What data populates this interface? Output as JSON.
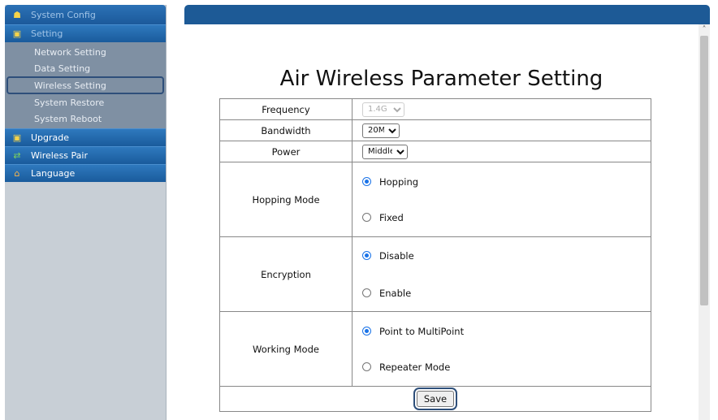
{
  "sidebar": {
    "header": "System Config",
    "setting_label": "Setting",
    "sub_items": [
      "Network Setting",
      "Data Setting",
      "Wireless Setting",
      "System Restore",
      "System Reboot"
    ],
    "upgrade_label": "Upgrade",
    "wireless_pair_label": "Wireless Pair",
    "language_label": "Language"
  },
  "page": {
    "title": "Air Wireless Parameter Setting"
  },
  "form": {
    "frequency": {
      "label": "Frequency",
      "value": "1.4G"
    },
    "bandwidth": {
      "label": "Bandwidth",
      "value": "20M"
    },
    "power": {
      "label": "Power",
      "value": "Middle"
    },
    "hopping_mode": {
      "label": "Hopping Mode",
      "options": [
        "Hopping",
        "Fixed"
      ],
      "selected": "Hopping"
    },
    "encryption": {
      "label": "Encryption",
      "options": [
        "Disable",
        "Enable"
      ],
      "selected": "Disable"
    },
    "working_mode": {
      "label": "Working Mode",
      "options": [
        "Point to MultiPoint",
        "Repeater Mode"
      ],
      "selected": "Point to MultiPoint"
    },
    "save_label": "Save"
  },
  "colors": {
    "sidebar_header": "#1b5a9b",
    "main_topbar": "#1d5a96",
    "radio_accent": "#1a73e8"
  }
}
